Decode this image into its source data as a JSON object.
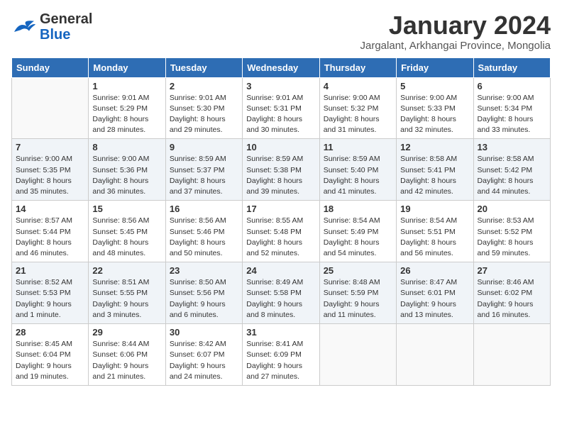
{
  "header": {
    "logo_general": "General",
    "logo_blue": "Blue",
    "month": "January 2024",
    "location": "Jargalant, Arkhangai Province, Mongolia"
  },
  "days_of_week": [
    "Sunday",
    "Monday",
    "Tuesday",
    "Wednesday",
    "Thursday",
    "Friday",
    "Saturday"
  ],
  "weeks": [
    [
      {
        "day": "",
        "sunrise": "",
        "sunset": "",
        "daylight": ""
      },
      {
        "day": "1",
        "sunrise": "Sunrise: 9:01 AM",
        "sunset": "Sunset: 5:29 PM",
        "daylight": "Daylight: 8 hours and 28 minutes."
      },
      {
        "day": "2",
        "sunrise": "Sunrise: 9:01 AM",
        "sunset": "Sunset: 5:30 PM",
        "daylight": "Daylight: 8 hours and 29 minutes."
      },
      {
        "day": "3",
        "sunrise": "Sunrise: 9:01 AM",
        "sunset": "Sunset: 5:31 PM",
        "daylight": "Daylight: 8 hours and 30 minutes."
      },
      {
        "day": "4",
        "sunrise": "Sunrise: 9:00 AM",
        "sunset": "Sunset: 5:32 PM",
        "daylight": "Daylight: 8 hours and 31 minutes."
      },
      {
        "day": "5",
        "sunrise": "Sunrise: 9:00 AM",
        "sunset": "Sunset: 5:33 PM",
        "daylight": "Daylight: 8 hours and 32 minutes."
      },
      {
        "day": "6",
        "sunrise": "Sunrise: 9:00 AM",
        "sunset": "Sunset: 5:34 PM",
        "daylight": "Daylight: 8 hours and 33 minutes."
      }
    ],
    [
      {
        "day": "7",
        "sunrise": "Sunrise: 9:00 AM",
        "sunset": "Sunset: 5:35 PM",
        "daylight": "Daylight: 8 hours and 35 minutes."
      },
      {
        "day": "8",
        "sunrise": "Sunrise: 9:00 AM",
        "sunset": "Sunset: 5:36 PM",
        "daylight": "Daylight: 8 hours and 36 minutes."
      },
      {
        "day": "9",
        "sunrise": "Sunrise: 8:59 AM",
        "sunset": "Sunset: 5:37 PM",
        "daylight": "Daylight: 8 hours and 37 minutes."
      },
      {
        "day": "10",
        "sunrise": "Sunrise: 8:59 AM",
        "sunset": "Sunset: 5:38 PM",
        "daylight": "Daylight: 8 hours and 39 minutes."
      },
      {
        "day": "11",
        "sunrise": "Sunrise: 8:59 AM",
        "sunset": "Sunset: 5:40 PM",
        "daylight": "Daylight: 8 hours and 41 minutes."
      },
      {
        "day": "12",
        "sunrise": "Sunrise: 8:58 AM",
        "sunset": "Sunset: 5:41 PM",
        "daylight": "Daylight: 8 hours and 42 minutes."
      },
      {
        "day": "13",
        "sunrise": "Sunrise: 8:58 AM",
        "sunset": "Sunset: 5:42 PM",
        "daylight": "Daylight: 8 hours and 44 minutes."
      }
    ],
    [
      {
        "day": "14",
        "sunrise": "Sunrise: 8:57 AM",
        "sunset": "Sunset: 5:44 PM",
        "daylight": "Daylight: 8 hours and 46 minutes."
      },
      {
        "day": "15",
        "sunrise": "Sunrise: 8:56 AM",
        "sunset": "Sunset: 5:45 PM",
        "daylight": "Daylight: 8 hours and 48 minutes."
      },
      {
        "day": "16",
        "sunrise": "Sunrise: 8:56 AM",
        "sunset": "Sunset: 5:46 PM",
        "daylight": "Daylight: 8 hours and 50 minutes."
      },
      {
        "day": "17",
        "sunrise": "Sunrise: 8:55 AM",
        "sunset": "Sunset: 5:48 PM",
        "daylight": "Daylight: 8 hours and 52 minutes."
      },
      {
        "day": "18",
        "sunrise": "Sunrise: 8:54 AM",
        "sunset": "Sunset: 5:49 PM",
        "daylight": "Daylight: 8 hours and 54 minutes."
      },
      {
        "day": "19",
        "sunrise": "Sunrise: 8:54 AM",
        "sunset": "Sunset: 5:51 PM",
        "daylight": "Daylight: 8 hours and 56 minutes."
      },
      {
        "day": "20",
        "sunrise": "Sunrise: 8:53 AM",
        "sunset": "Sunset: 5:52 PM",
        "daylight": "Daylight: 8 hours and 59 minutes."
      }
    ],
    [
      {
        "day": "21",
        "sunrise": "Sunrise: 8:52 AM",
        "sunset": "Sunset: 5:53 PM",
        "daylight": "Daylight: 9 hours and 1 minute."
      },
      {
        "day": "22",
        "sunrise": "Sunrise: 8:51 AM",
        "sunset": "Sunset: 5:55 PM",
        "daylight": "Daylight: 9 hours and 3 minutes."
      },
      {
        "day": "23",
        "sunrise": "Sunrise: 8:50 AM",
        "sunset": "Sunset: 5:56 PM",
        "daylight": "Daylight: 9 hours and 6 minutes."
      },
      {
        "day": "24",
        "sunrise": "Sunrise: 8:49 AM",
        "sunset": "Sunset: 5:58 PM",
        "daylight": "Daylight: 9 hours and 8 minutes."
      },
      {
        "day": "25",
        "sunrise": "Sunrise: 8:48 AM",
        "sunset": "Sunset: 5:59 PM",
        "daylight": "Daylight: 9 hours and 11 minutes."
      },
      {
        "day": "26",
        "sunrise": "Sunrise: 8:47 AM",
        "sunset": "Sunset: 6:01 PM",
        "daylight": "Daylight: 9 hours and 13 minutes."
      },
      {
        "day": "27",
        "sunrise": "Sunrise: 8:46 AM",
        "sunset": "Sunset: 6:02 PM",
        "daylight": "Daylight: 9 hours and 16 minutes."
      }
    ],
    [
      {
        "day": "28",
        "sunrise": "Sunrise: 8:45 AM",
        "sunset": "Sunset: 6:04 PM",
        "daylight": "Daylight: 9 hours and 19 minutes."
      },
      {
        "day": "29",
        "sunrise": "Sunrise: 8:44 AM",
        "sunset": "Sunset: 6:06 PM",
        "daylight": "Daylight: 9 hours and 21 minutes."
      },
      {
        "day": "30",
        "sunrise": "Sunrise: 8:42 AM",
        "sunset": "Sunset: 6:07 PM",
        "daylight": "Daylight: 9 hours and 24 minutes."
      },
      {
        "day": "31",
        "sunrise": "Sunrise: 8:41 AM",
        "sunset": "Sunset: 6:09 PM",
        "daylight": "Daylight: 9 hours and 27 minutes."
      },
      {
        "day": "",
        "sunrise": "",
        "sunset": "",
        "daylight": ""
      },
      {
        "day": "",
        "sunrise": "",
        "sunset": "",
        "daylight": ""
      },
      {
        "day": "",
        "sunrise": "",
        "sunset": "",
        "daylight": ""
      }
    ]
  ]
}
